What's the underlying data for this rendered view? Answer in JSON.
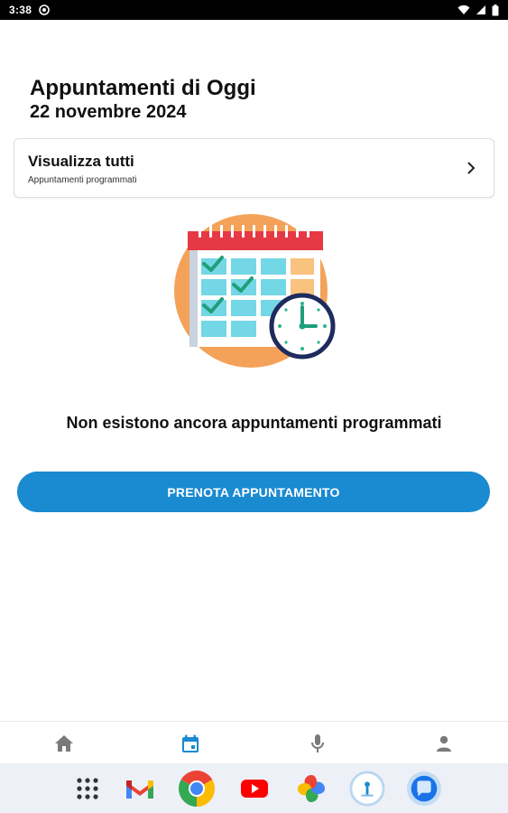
{
  "status_bar": {
    "time": "3:38"
  },
  "header": {
    "title": "Appuntamenti di Oggi",
    "date": "22 novembre 2024"
  },
  "view_all": {
    "title": "Visualizza tutti",
    "subtitle": "Appuntamenti programmati",
    "icon": "chevron-right-icon"
  },
  "empty_state": {
    "message": "Non esistono ancora appuntamenti programmati",
    "illustration": "calendar-clock-illustration"
  },
  "actions": {
    "book_label": "PRENOTA APPUNTAMENTO",
    "book_color": "#1a8ad1"
  },
  "bottom_nav": {
    "items": [
      {
        "icon": "home-icon",
        "active": false
      },
      {
        "icon": "calendar-icon",
        "active": true
      },
      {
        "icon": "microphone-icon",
        "active": false
      },
      {
        "icon": "person-icon",
        "active": false
      }
    ],
    "active_color": "#1a8ad1",
    "inactive_color": "#7a7a7a"
  },
  "dock": {
    "apps": [
      "app-drawer-icon",
      "gmail-icon",
      "chrome-icon",
      "youtube-icon",
      "photos-icon",
      "app-icon",
      "messages-icon"
    ]
  }
}
